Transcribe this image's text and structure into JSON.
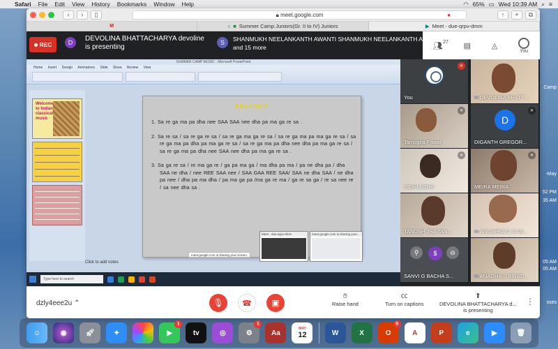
{
  "menubar": {
    "app": "Safari",
    "items": [
      "File",
      "Edit",
      "View",
      "History",
      "Bookmarks",
      "Window",
      "Help"
    ],
    "battery": "65%",
    "clock": "Wed 10:39 AM"
  },
  "desktop_labels": [
    "Camp",
    "-May",
    "52 PM",
    "35 AM",
    "05 AM",
    "05 AM",
    "sses"
  ],
  "browser": {
    "url": "meet.google.com",
    "tabs": [
      {
        "label": "M",
        "x": "x"
      },
      {
        "label": "Summer Camp Juniors(Gr. II to IV) Juniors"
      },
      {
        "label": "Meet - due-qrpv-dmm"
      }
    ]
  },
  "meet": {
    "rec_label": "REC",
    "presenter_initial": "D",
    "presenter_line1": "DEVOLINA BHATTACHARYA devoline",
    "presenter_line2": "is presenting",
    "participants_initial": "S",
    "participants_line1": "SHANMUKH NEELANKANTH AWANTI SHANMUKH NEELANKANTH AW...",
    "participants_line2": "and 15 more",
    "people_count": "27",
    "you_label": "You",
    "colors": {
      "rec": "#d93025",
      "avatar_d": "#7b3fbf",
      "avatar_s": "#5a5fb5",
      "tile_blue": "#1a73e8"
    }
  },
  "shared_screen": {
    "window_title": "SUMMER CAMP MUSIC - Microsoft PowerPoint",
    "ribbon_tabs": "Home Insert Design Animations Slide Show Review View",
    "thumb1_text": "Welcome to Indian classical music",
    "slide_title": "PRACTICE",
    "slide_items": [
      "1.  Sa re ga ma pa dha nee SAA SAA nee dha pa ma ga re sa .",
      "2.  Sa re sa / sa re ga re sa / sa re ga ma ga re sa / sa re ga ma pa ma ga re sa / sa re ga ma pa dha pa ma ga re sa / sa re ga ma pa dha nee dha pa ma ga re sa / sa re ga ma pa dha nee SAA nee dha pa ma ga re sa .",
      "3.  Sa ga re sa / re ma ga re / ga pa ma ga / ma dha pa ma / pa ne dha pa / dha SAA ne dha / nee REE SAA nee / SAA GAA REE SAA/ SAA ne dha SAA / ne dha pa nee / dha pa ma dha / pa ma ga pa /ma ga re ma / ga re sa ga / re sa nee re / sa nee dha sa ."
    ],
    "notes_placeholder": "Click to add notes",
    "share_bar_text": "meet.google.com is sharing your screen.",
    "taskbar_search": "Type here to search",
    "mini_win1": "Meet - due-qrpv-dmm",
    "mini_win2": "meet.google.com is sharing your..."
  },
  "tiles": [
    {
      "name": "You",
      "kind": "logo"
    },
    {
      "name": "DEVOLINA BHATT...",
      "kind": "video"
    },
    {
      "name": "Tamogna Pawar",
      "kind": "video"
    },
    {
      "name": "DIGANTH GREGOR...",
      "kind": "avatar",
      "initial": "D"
    },
    {
      "name": "NIDHI NIDHI",
      "kind": "video"
    },
    {
      "name": "MEIRA MEIRA",
      "kind": "video"
    },
    {
      "name": "TANUSH JHA TAN...",
      "kind": "video"
    },
    {
      "name": "ANUSHKA C S AN...",
      "kind": "video"
    },
    {
      "name": "SANVI G BACHA S...",
      "kind": "video"
    },
    {
      "name": "ANAGHA S BIRAD...",
      "kind": "video"
    }
  ],
  "bottom_bar": {
    "meeting_code": "dzly4eee2u",
    "raise_hand": "Raise hand",
    "captions": "Turn on captions",
    "presenting_line1": "DEVOLINA BHATTACHARYA d...",
    "presenting_line2": "is presenting"
  },
  "dock": {
    "badges": {
      "facetime": "1",
      "sysprefs": "1",
      "office": "5"
    },
    "calendar_month": "MAY",
    "calendar_day": "12",
    "apps": [
      "Finder",
      "Siri",
      "Launchpad",
      "Safari",
      "Photos",
      "FaceTime",
      "Apple TV",
      "Podcasts",
      "System Preferences",
      "Dictionary",
      "Calendar",
      "Word",
      "Excel",
      "Office",
      "Acrobat",
      "PowerPoint",
      "Edge",
      "Zoom",
      "Trash"
    ]
  }
}
